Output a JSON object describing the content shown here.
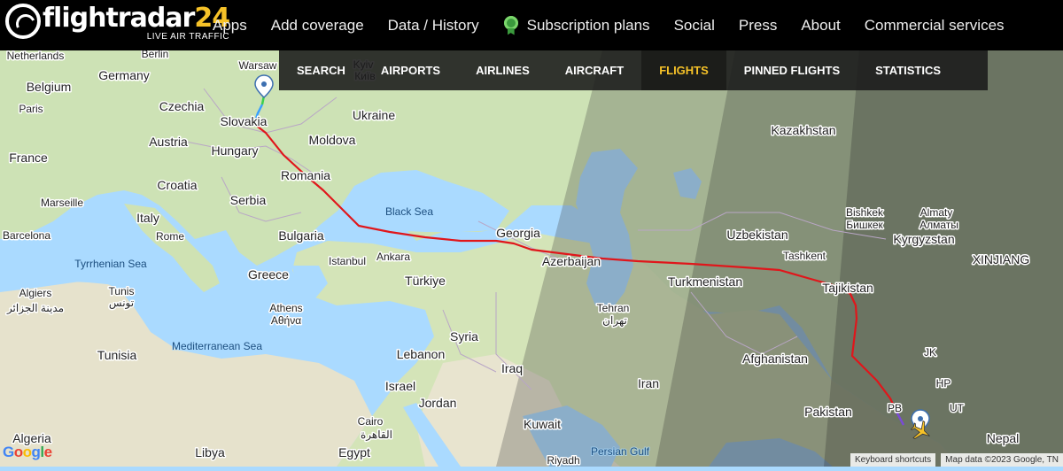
{
  "brand": {
    "name": "flightradar",
    "number": "24",
    "tagline": "LIVE AIR TRAFFIC"
  },
  "top_nav": [
    "Apps",
    "Add coverage",
    "Data / History",
    "Subscription plans",
    "Social",
    "Press",
    "About",
    "Commercial services"
  ],
  "sub_nav": {
    "tabs": [
      "SEARCH",
      "AIRPORTS",
      "AIRLINES",
      "AIRCRAFT",
      "FLIGHTS",
      "PINNED FLIGHTS",
      "STATISTICS"
    ],
    "active": "FLIGHTS"
  },
  "map_labels": {
    "countries": [
      "Belgium",
      "Germany",
      "Czechia",
      "Slovakia",
      "Ukraine",
      "France",
      "Austria",
      "Hungary",
      "Moldova",
      "Romania",
      "Croatia",
      "Serbia",
      "Italy",
      "Bulgaria",
      "Georgia",
      "Azerbaijan",
      "Greece",
      "Türkiye",
      "Tunisia",
      "Algeria",
      "Libya",
      "Egypt",
      "Syria",
      "Lebanon",
      "Israel",
      "Jordan",
      "Iraq",
      "Iran",
      "Kuwait",
      "Kazakhstan",
      "Uzbekistan",
      "Kyrgyzstan",
      "Tajikistan",
      "Turkmenistan",
      "Afghanistan",
      "Pakistan",
      "Nepal",
      "XINJIANG"
    ],
    "cities": [
      "Warsaw",
      "Kyiv",
      "Київ",
      "Paris",
      "Marseille",
      "Barcelona",
      "Rome",
      "Istanbul",
      "Ankara",
      "Athens",
      "Αθήνα",
      "Algiers",
      "مدينة الجزائر",
      "Tunis",
      "تونس",
      "Cairo",
      "القاهرة",
      "Tehran",
      "تهران",
      "Bishkek",
      "Бишкек",
      "Almaty",
      "Алматы",
      "Tashkent",
      "Riyadh"
    ],
    "seas": [
      "Black Sea",
      "Tyrrhenian Sea",
      "Mediterranean Sea",
      "Persian Gulf"
    ],
    "partial": [
      "Netherlands",
      "Berlin",
      "JK",
      "HP",
      "UT",
      "PB"
    ]
  },
  "map_footer": {
    "google": "Google",
    "shortcuts": "Keyboard shortcuts",
    "data": "Map data ©2023 Google, TN"
  },
  "colors": {
    "route": "#e0161b",
    "active_tab": "#f6c228",
    "header_bg": "#000000",
    "water": "#aadaff",
    "land": "#c9dfb0"
  }
}
